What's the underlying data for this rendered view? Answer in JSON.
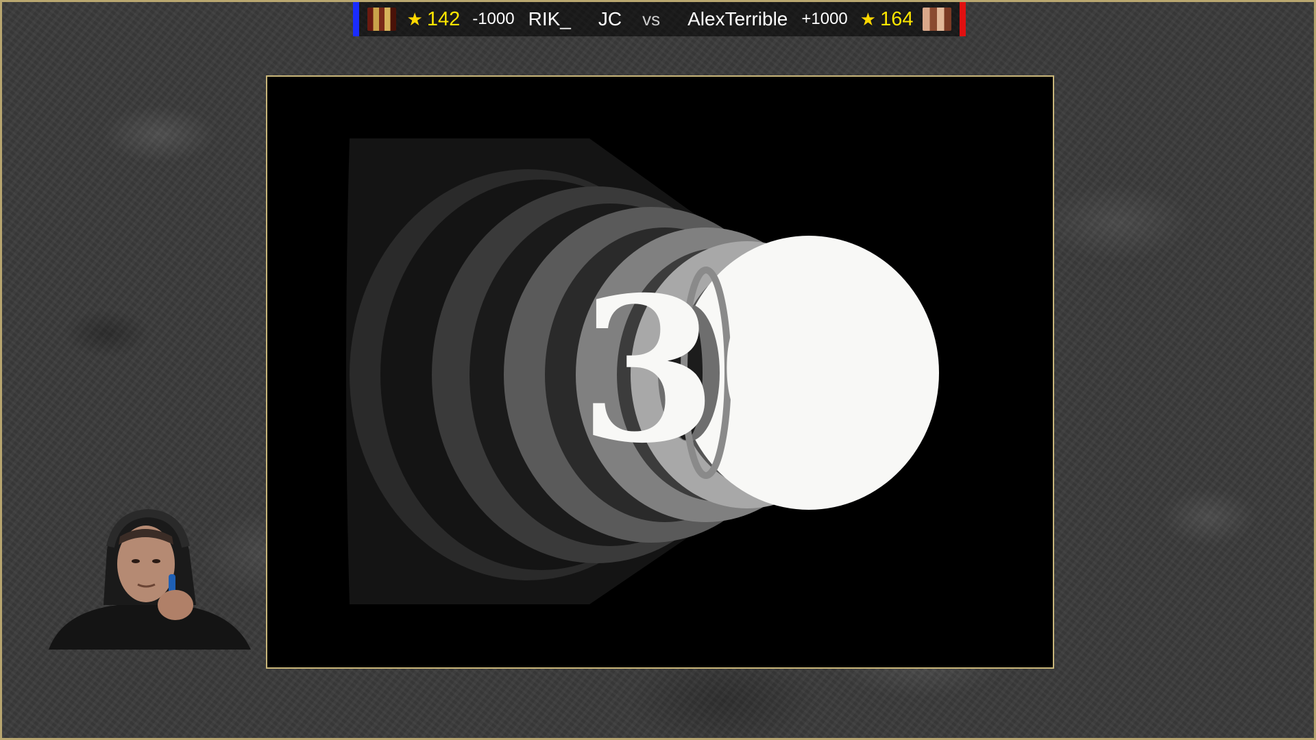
{
  "scoreboard": {
    "left_player": {
      "rating": "142",
      "delta": "-1000",
      "name": "RIK_",
      "tag": "JC"
    },
    "vs_label": "vs",
    "right_player": {
      "name": "AlexTerrible",
      "delta": "+1000",
      "rating": "164"
    },
    "left_color": "#1a2cff",
    "right_color": "#e01010",
    "rating_color": "#ffe600"
  },
  "screen": {
    "countdown_text": "30",
    "frame_color": "#c9b67a"
  },
  "icons": {
    "rating": "star-icon"
  }
}
